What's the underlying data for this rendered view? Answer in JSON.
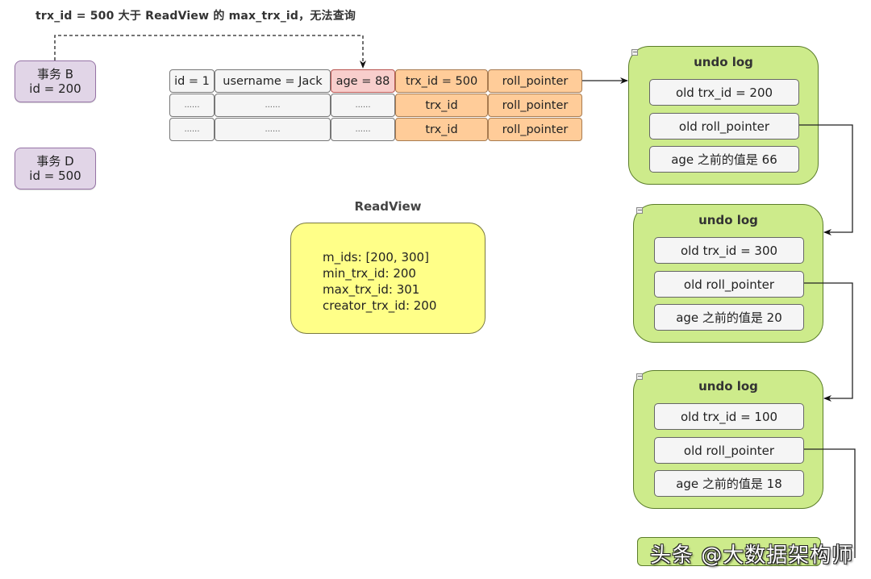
{
  "caption": "trx_id = 500 大于 ReadView 的 max_trx_id，无法查询",
  "transactions": [
    {
      "name": "事务 B",
      "id_label": "id = 200"
    },
    {
      "name": "事务 D",
      "id_label": "id = 500"
    }
  ],
  "record_rows": [
    [
      "id = 1",
      "username = Jack",
      "age = 88",
      "trx_id = 500",
      "roll_pointer"
    ],
    [
      "......",
      "......",
      "......",
      "trx_id",
      "roll_pointer"
    ],
    [
      "......",
      "......",
      "......",
      "trx_id",
      "roll_pointer"
    ]
  ],
  "readview": {
    "title": "ReadView",
    "lines": [
      "m_ids: [200, 300]",
      "min_trx_id: 200",
      "max_trx_id: 301",
      "creator_trx_id: 200"
    ]
  },
  "undo_logs": [
    {
      "title": "undo log",
      "trx": "old trx_id = 200",
      "pointer": "old roll_pointer",
      "age": "age 之前的值是 66"
    },
    {
      "title": "undo log",
      "trx": "old trx_id = 300",
      "pointer": "old roll_pointer",
      "age": "age 之前的值是 20"
    },
    {
      "title": "undo log",
      "trx": "old trx_id = 100",
      "pointer": "old roll_pointer",
      "age": "age 之前的值是 18"
    }
  ],
  "collapse_glyph": "−",
  "watermark": "头条 @大数据架构师",
  "colors": {
    "txn_fill": "#e1d5e7",
    "pink_cell": "#f8cecc",
    "orange_cell": "#ffcc99",
    "undo_fill": "#cdeb8b",
    "readview_fill": "#ffff88"
  }
}
